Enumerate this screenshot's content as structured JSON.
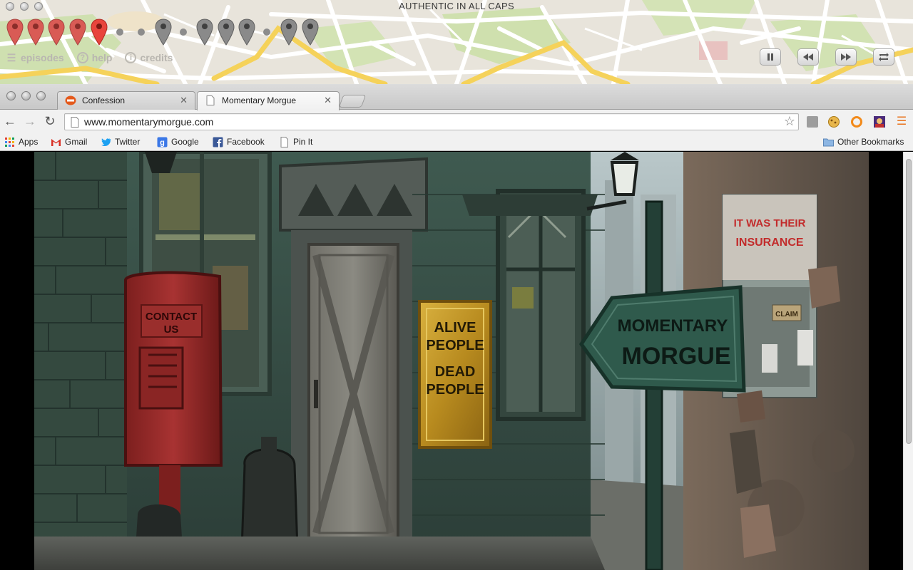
{
  "game": {
    "title": "AUTHENTIC IN ALL CAPS",
    "nav": [
      {
        "label": "episodes",
        "icon": "list-icon"
      },
      {
        "label": "help",
        "icon": "question-icon"
      },
      {
        "label": "credits",
        "icon": "info-icon"
      }
    ],
    "controls": [
      "pause-icon",
      "rewind-icon",
      "fast-forward-icon",
      "loop-icon"
    ],
    "pin_colors": {
      "visited": "#d95b55",
      "current": "#e8453c",
      "unvisited": "#8a8a8a"
    }
  },
  "browser": {
    "tabs": [
      {
        "title": "Confession",
        "favicon": "confession-favicon",
        "active": false
      },
      {
        "title": "Momentary Morgue",
        "favicon": "page-icon",
        "active": true
      }
    ],
    "url": "www.momentarymorgue.com",
    "bookmarks": [
      {
        "label": "Apps",
        "icon": "apps-grid-icon"
      },
      {
        "label": "Gmail",
        "icon": "gmail-icon"
      },
      {
        "label": "Twitter",
        "icon": "twitter-icon"
      },
      {
        "label": "Google",
        "icon": "google-icon"
      },
      {
        "label": "Facebook",
        "icon": "facebook-icon"
      },
      {
        "label": "Pin It",
        "icon": "page-icon"
      }
    ],
    "other_bookmarks": "Other Bookmarks"
  },
  "scene": {
    "mailbox_sign": [
      "CONTACT",
      "US"
    ],
    "door_sign": [
      "ALIVE",
      "PEOPLE",
      "DEAD",
      "PEOPLE"
    ],
    "arrow_sign": [
      "MOMENTARY",
      "MORGUE"
    ],
    "poster_top": [
      "IT WAS THEIR",
      "INSURANCE"
    ],
    "poster_claim": "CLAIM"
  }
}
